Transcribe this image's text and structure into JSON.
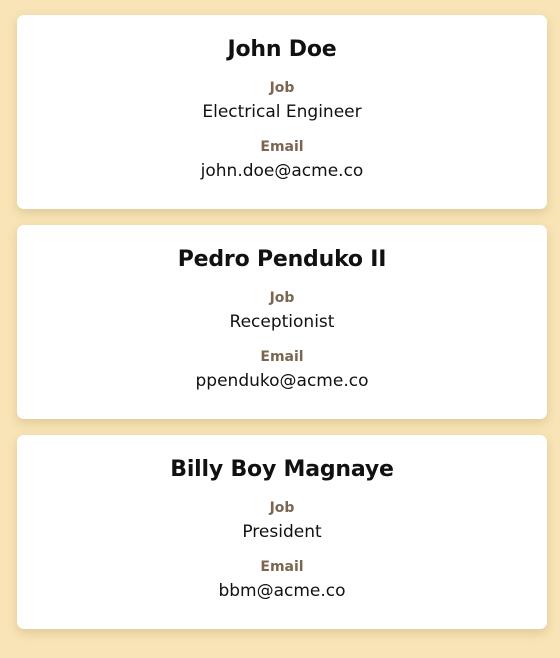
{
  "people": [
    {
      "name": "John Doe",
      "job_label": "Job",
      "job": "Electrical Engineer",
      "email_label": "Email",
      "email": "john.doe@acme.co"
    },
    {
      "name": "Pedro Penduko II",
      "job_label": "Job",
      "job": "Receptionist",
      "email_label": "Email",
      "email": "ppenduko@acme.co"
    },
    {
      "name": "Billy Boy Magnaye",
      "job_label": "Job",
      "job": "President",
      "email_label": "Email",
      "email": "bbm@acme.co"
    }
  ],
  "colors": {
    "background": "#f8e4b6",
    "card": "#ffffff",
    "label": "#7b6751",
    "text": "#111111"
  }
}
